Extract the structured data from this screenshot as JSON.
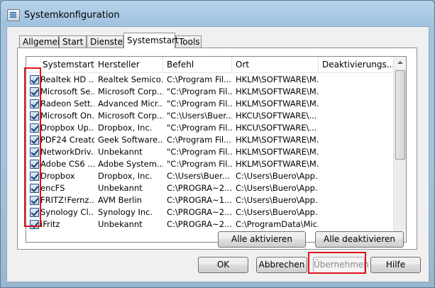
{
  "window": {
    "title": "Systemkonfiguration"
  },
  "tabs": [
    {
      "label": "Allgemein"
    },
    {
      "label": "Start"
    },
    {
      "label": "Dienste"
    },
    {
      "label": "Systemstart"
    },
    {
      "label": "Tools"
    }
  ],
  "active_tab": "Systemstart",
  "table": {
    "columns": [
      "Systemstartele...",
      "Hersteller",
      "Befehl",
      "Ort",
      "Deaktivierungs..."
    ],
    "rows": [
      {
        "checked": true,
        "item": "Realtek HD ...",
        "vendor": "Realtek Semico...",
        "command": "C:\\Program Fil...",
        "location": "HKLM\\SOFTWARE\\M..."
      },
      {
        "checked": true,
        "item": "Microsoft Se...",
        "vendor": "Microsoft Corp...",
        "command": "\"C:\\Program Fil...",
        "location": "HKLM\\SOFTWARE\\M..."
      },
      {
        "checked": true,
        "item": "Radeon Sett...",
        "vendor": "Advanced Micr...",
        "command": "\"C:\\Program Fil...",
        "location": "HKLM\\SOFTWARE\\M..."
      },
      {
        "checked": true,
        "item": "Microsoft On...",
        "vendor": "Microsoft Corp...",
        "command": "\"C:\\Users\\Buer...",
        "location": "HKCU\\SOFTWARE\\..."
      },
      {
        "checked": true,
        "item": "Dropbox Up...",
        "vendor": "Dropbox, Inc.",
        "command": "\"C:\\Program Fil...",
        "location": "HKCU\\SOFTWARE\\..."
      },
      {
        "checked": true,
        "item": "PDF24 Creator",
        "vendor": "Geek Software...",
        "command": "C:\\Program Fil...",
        "location": "HKLM\\SOFTWARE\\M..."
      },
      {
        "checked": true,
        "item": "NetworkDriv...",
        "vendor": "Unbekannt",
        "command": "\"C:\\Program Fil...",
        "location": "HKLM\\SOFTWARE\\M..."
      },
      {
        "checked": true,
        "item": "Adobe CS6 ...",
        "vendor": "Adobe System...",
        "command": "\"C:\\Program Fil...",
        "location": "HKLM\\SOFTWARE\\M..."
      },
      {
        "checked": true,
        "item": "Dropbox",
        "vendor": "Dropbox, Inc.",
        "command": "C:\\Users\\Buer...",
        "location": "C:\\Users\\Buero\\App..."
      },
      {
        "checked": true,
        "item": "encFS",
        "vendor": "Unbekannt",
        "command": "C:\\PROGRA~2...",
        "location": "C:\\Users\\Buero\\App..."
      },
      {
        "checked": true,
        "item": "FRITZ!Fernz...",
        "vendor": "AVM Berlin",
        "command": "C:\\PROGRA~1...",
        "location": "C:\\Users\\Buero\\App..."
      },
      {
        "checked": true,
        "item": "Synology Cl...",
        "vendor": "Synology Inc.",
        "command": "C:\\PROGRA~2...",
        "location": "C:\\Users\\Buero\\App..."
      },
      {
        "checked": true,
        "item": "iFritz",
        "vendor": "Unbekannt",
        "command": "C:\\PROGRA~2...",
        "location": "C:\\ProgramData\\Mic..."
      }
    ]
  },
  "buttons": {
    "enable_all": "Alle aktivieren",
    "disable_all": "Alle deaktivieren",
    "ok": "OK",
    "cancel": "Abbrechen",
    "apply": "Übernehmen",
    "help": "Hilfe"
  },
  "colors": {
    "highlight": "#e0141c",
    "title_bar": "#a5c4e1",
    "checkbox_border": "#1c5180"
  },
  "icons": {
    "app": "system-config-icon",
    "check": "checkmark-icon"
  }
}
